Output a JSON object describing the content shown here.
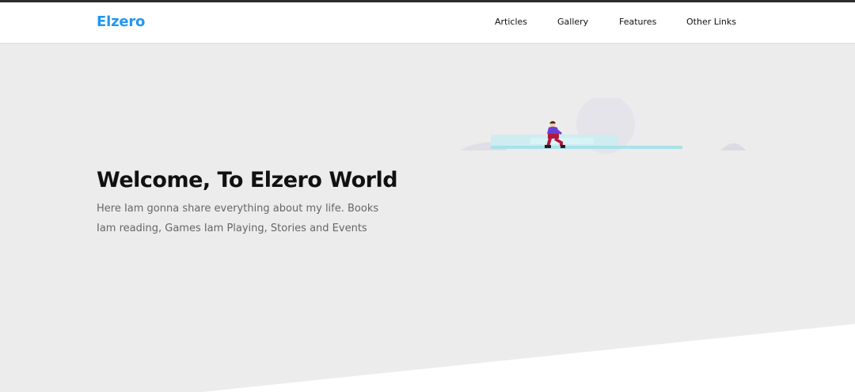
{
  "header": {
    "logo": "Elzero",
    "nav": [
      {
        "label": "Articles"
      },
      {
        "label": "Gallery"
      },
      {
        "label": "Features"
      },
      {
        "label": "Other Links"
      }
    ]
  },
  "hero": {
    "title": "Welcome, To Elzero World",
    "description": "Here Iam gonna share everything about my life. Books Iam reading, Games Iam Playing, Stories and Events",
    "illustration_icon": "kneeling-person-illustration"
  },
  "colors": {
    "brand": "#2196f3",
    "hero_background": "#ececec",
    "title": "#111111",
    "description": "#666666"
  }
}
